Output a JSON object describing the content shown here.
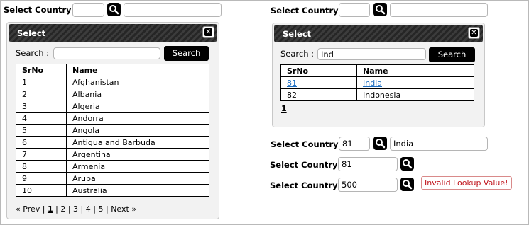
{
  "left": {
    "label": "Select Country :",
    "code_value": "",
    "name_value": "",
    "popup": {
      "title": "Select",
      "close_icon": "close-icon",
      "search_label": "Search :",
      "search_value": "",
      "search_button": "Search",
      "columns": [
        "SrNo",
        "Name"
      ],
      "rows": [
        {
          "srno": "1",
          "name": "Afghanistan"
        },
        {
          "srno": "2",
          "name": "Albania"
        },
        {
          "srno": "3",
          "name": "Algeria"
        },
        {
          "srno": "4",
          "name": "Andorra"
        },
        {
          "srno": "5",
          "name": "Angola"
        },
        {
          "srno": "6",
          "name": "Antigua and Barbuda"
        },
        {
          "srno": "7",
          "name": "Argentina"
        },
        {
          "srno": "8",
          "name": "Armenia"
        },
        {
          "srno": "9",
          "name": "Aruba"
        },
        {
          "srno": "10",
          "name": "Australia"
        }
      ],
      "pager": {
        "prev": "« Prev",
        "sep": "|",
        "pages": [
          "1",
          "2",
          "3",
          "4",
          "5"
        ],
        "current": "1",
        "next": "Next »"
      }
    }
  },
  "right": {
    "top": {
      "label": "Select Country :",
      "code_value": "",
      "name_value": ""
    },
    "popup": {
      "title": "Select",
      "close_icon": "close-icon",
      "search_label": "Search :",
      "search_value": "Ind",
      "search_button": "Search",
      "columns": [
        "SrNo",
        "Name"
      ],
      "rows": [
        {
          "srno": "81",
          "name": "India",
          "linked": true
        },
        {
          "srno": "82",
          "name": "Indonesia",
          "linked": false
        }
      ],
      "pager": {
        "current": "1"
      }
    },
    "row1": {
      "label": "Select Country :",
      "code_value": "81",
      "name_value": "India"
    },
    "row2": {
      "label": "Select Country :",
      "code_value": "81"
    },
    "row3": {
      "label": "Select Country :",
      "code_value": "500",
      "error": "Invalid Lookup Value!"
    }
  },
  "icons": {
    "lookup": "search-icon"
  }
}
